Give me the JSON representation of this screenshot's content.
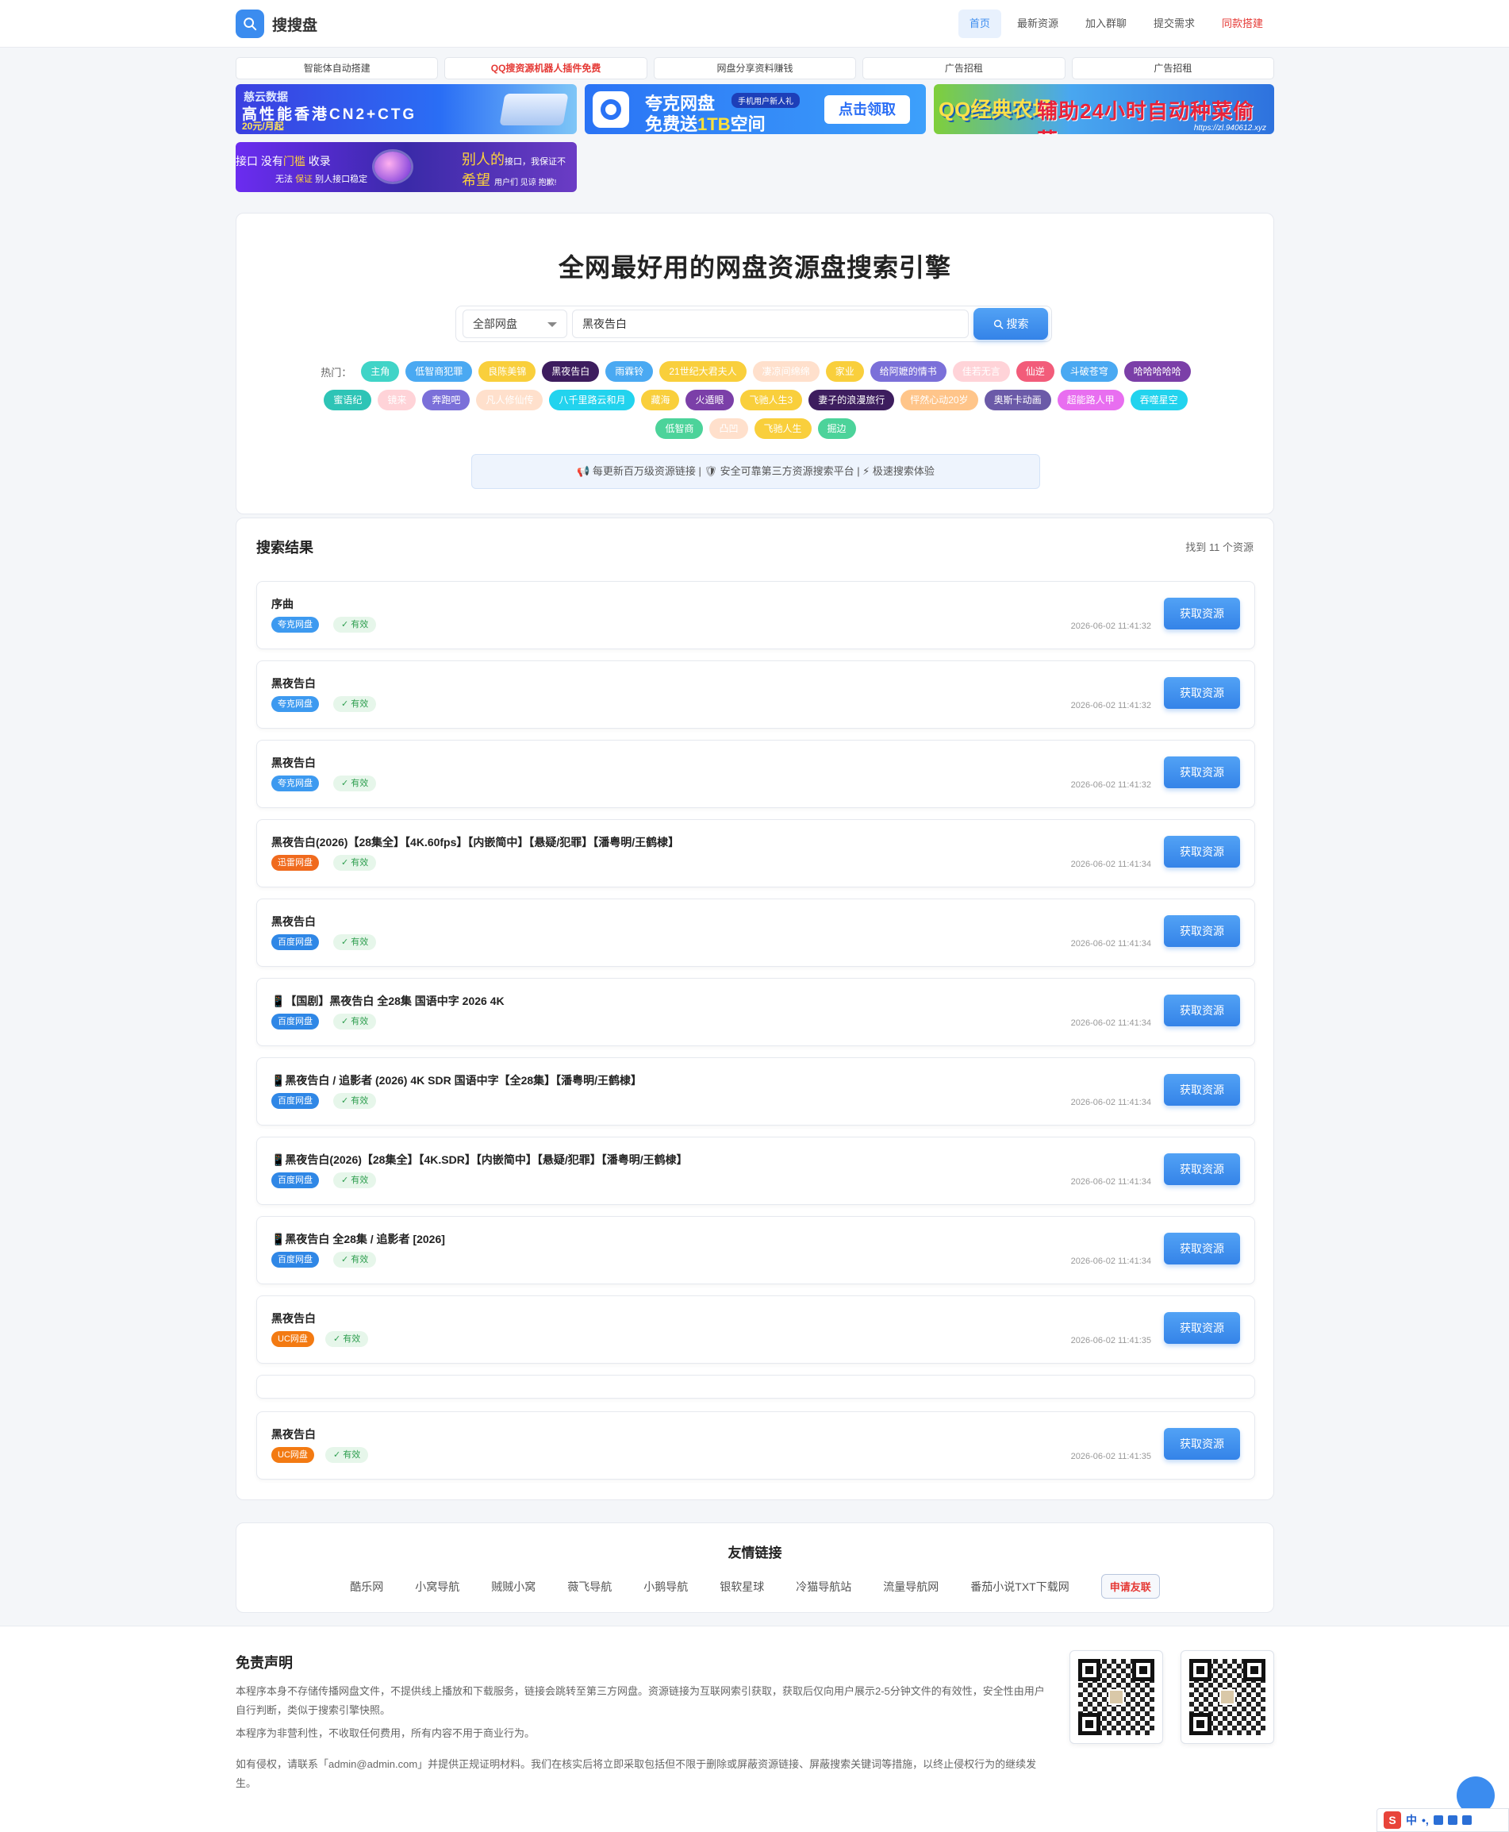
{
  "header": {
    "logo_text": "搜搜盘",
    "nav": [
      {
        "label": "首页",
        "style": "active"
      },
      {
        "label": "最新资源",
        "style": ""
      },
      {
        "label": "加入群聊",
        "style": ""
      },
      {
        "label": "提交需求",
        "style": ""
      },
      {
        "label": "同款搭建",
        "style": "red"
      }
    ]
  },
  "text_ads": [
    {
      "label": "智能体自动搭建",
      "red": false
    },
    {
      "label": "QQ搜资源机器人插件免费",
      "red": true
    },
    {
      "label": "网盘分享资料赚钱",
      "red": false
    },
    {
      "label": "广告招租",
      "red": false
    },
    {
      "label": "广告招租",
      "red": false
    }
  ],
  "banners": {
    "b1": {
      "brand": "慈云数据",
      "headline": "高性能香港CN2+CTG",
      "price": "20元/月起"
    },
    "b2": {
      "brand": "夸克网盘",
      "badge": "手机用户新人礼",
      "headline_pre": "免费送",
      "headline_hl": "1TB",
      "headline_post": "空间",
      "cta": "点击领取"
    },
    "b3": {
      "title_a": "QQ经典农场",
      "title_b": "辅助24小时自动种菜偷菜",
      "url": "https://zl.940612.xyz"
    },
    "b4": {
      "a1": "接口 没有",
      "a1_hl": "门槛",
      "a1_post": " 收录",
      "a2_pre": "无法 ",
      "a2_hl": "保证",
      "a2_post": " 别人接口稳定",
      "b1": "别人的",
      "b1_small": "接口，我保证不",
      "b2": "希望",
      "b2_small": "用户们 见谅 抱歉!"
    }
  },
  "search": {
    "hero_title": "全网最好用的网盘资源盘搜索引擎",
    "select_value": "全部网盘",
    "query": "黑夜告白",
    "button_label": "搜索",
    "hot_label": "热门：",
    "notice": "📢 每更新百万级资源链接 | 🛡 安全可靠第三方资源搜索平台 | ⚡ 极速搜索体验",
    "hot_rows": [
      [
        {
          "label": "主角",
          "color": "#40d4c7"
        },
        {
          "label": "低智商犯罪",
          "color": "#4aa9f2"
        },
        {
          "label": "良陈美锦",
          "color": "#f9cf3c"
        },
        {
          "label": "黑夜告白",
          "color": "#3d1d5e"
        },
        {
          "label": "雨霖铃",
          "color": "#4aa9f2"
        },
        {
          "label": "21世纪大君夫人",
          "color": "#f9cf3c"
        },
        {
          "label": "凄凉间绵绵",
          "color": "#ffe0cc"
        },
        {
          "label": "家业",
          "color": "#f9cf3c"
        },
        {
          "label": "给阿嬷的情书",
          "color": "#7b70d9"
        },
        {
          "label": "佳若无言",
          "color": "#ffd3d8"
        },
        {
          "label": "仙逆",
          "color": "#f25c7a"
        },
        {
          "label": "斗破苍穹",
          "color": "#4aa9f2"
        },
        {
          "label": "哈哈哈哈哈",
          "color": "#7b3fa8"
        }
      ],
      [
        {
          "label": "蜜语纪",
          "color": "#2ec4b6"
        },
        {
          "label": "镜来",
          "color": "#ffd3d8"
        },
        {
          "label": "奔跑吧",
          "color": "#7b70d9"
        },
        {
          "label": "凡人修仙传",
          "color": "#ffe0cc"
        },
        {
          "label": "八千里路云和月",
          "color": "#22d3ee"
        },
        {
          "label": "藏海",
          "color": "#f9cf3c"
        },
        {
          "label": "火遁眼",
          "color": "#7b3fa8"
        },
        {
          "label": "飞驰人生3",
          "color": "#f9cf3c"
        },
        {
          "label": "妻子的浪漫旅行",
          "color": "#3d1d5e"
        },
        {
          "label": "怦然心动20岁",
          "color": "#ffc58a"
        },
        {
          "label": "奥斯卡动画",
          "color": "#6b5aa8"
        },
        {
          "label": "超能路人甲",
          "color": "#e86ef0"
        },
        {
          "label": "吞噬星空",
          "color": "#22d3ee"
        }
      ],
      [
        {
          "label": "低智商",
          "color": "#4cd39a"
        },
        {
          "label": "凸凹",
          "color": "#ffe0cc"
        },
        {
          "label": "飞驰人生",
          "color": "#f9cf3c"
        },
        {
          "label": "掘边",
          "color": "#4cd39a"
        }
      ]
    ]
  },
  "results": {
    "title": "搜索结果",
    "count": "找到 11 个资源",
    "get_label": "获取资源",
    "valid_label": "✓ 有效",
    "items": [
      {
        "title": "序曲",
        "disk": "夸克网盘",
        "disk_color": "#3d9af0",
        "time": "2026-06-02 11:41:32"
      },
      {
        "title": "黑夜告白",
        "disk": "夸克网盘",
        "disk_color": "#3d9af0",
        "time": "2026-06-02 11:41:32"
      },
      {
        "title": "黑夜告白",
        "disk": "夸克网盘",
        "disk_color": "#3d9af0",
        "time": "2026-06-02 11:41:32"
      },
      {
        "title": "黑夜告白(2026)【28集全】【4K.60fps】【内嵌简中】【悬疑/犯罪】【潘粤明/王鹤棣】",
        "disk": "迅雷网盘",
        "disk_color": "#f06a1d",
        "time": "2026-06-02 11:41:34"
      },
      {
        "title": "黑夜告白",
        "disk": "百度网盘",
        "disk_color": "#2f87e6",
        "time": "2026-06-02 11:41:34"
      },
      {
        "title": "📱【国剧】黑夜告白 全28集 国语中字 2026 4K",
        "disk": "百度网盘",
        "disk_color": "#2f87e6",
        "time": "2026-06-02 11:41:34"
      },
      {
        "title": "📱黑夜告白 / 追影者 (2026) 4K SDR 国语中字【全28集】【潘粤明/王鹤棣】",
        "disk": "百度网盘",
        "disk_color": "#2f87e6",
        "time": "2026-06-02 11:41:34"
      },
      {
        "title": "📱黑夜告白(2026)【28集全】【4K.SDR】【内嵌简中】【悬疑/犯罪】【潘粤明/王鹤棣】",
        "disk": "百度网盘",
        "disk_color": "#2f87e6",
        "time": "2026-06-02 11:41:34"
      },
      {
        "title": "📱黑夜告白 全28集 / 追影者 [2026]",
        "disk": "百度网盘",
        "disk_color": "#2f87e6",
        "time": "2026-06-02 11:41:34"
      },
      {
        "title": "黑夜告白",
        "disk": "UC网盘",
        "disk_color": "#f37a12",
        "time": "2026-06-02 11:41:35"
      },
      {
        "title": "",
        "disk": "",
        "disk_color": "",
        "time": ""
      },
      {
        "title": "黑夜告白",
        "disk": "UC网盘",
        "disk_color": "#f37a12",
        "time": "2026-06-02 11:41:35"
      }
    ]
  },
  "friends": {
    "title": "友情链接",
    "links": [
      "酷乐网",
      "小窝导航",
      "贼贼小窝",
      "薇飞导航",
      "小鹅导航",
      "银软星球",
      "冷猫导航站",
      "流量导航网",
      "番茄小说TXT下载网"
    ],
    "apply": "申请友联"
  },
  "footer": {
    "title": "免责声明",
    "p1": "本程序本身不存储传播网盘文件，不提供线上播放和下载服务，链接会跳转至第三方网盘。资源链接为互联网索引获取，获取后仅向用户展示2-5分钟文件的有效性，安全性由用户自行判断，类似于搜索引擎快照。",
    "p2": "本程序为非营利性，不收取任何费用，所有内容不用于商业行为。",
    "p3": "如有侵权，请联系「admin@admin.com」并提供正规证明材料。我们在核实后将立即采取包括但不限于删除或屏蔽资源链接、屏蔽搜索关键词等措施，以终止侵权行为的继续发生。"
  },
  "ime": {
    "logo": "S",
    "lang": "中",
    "punct": "•,"
  }
}
